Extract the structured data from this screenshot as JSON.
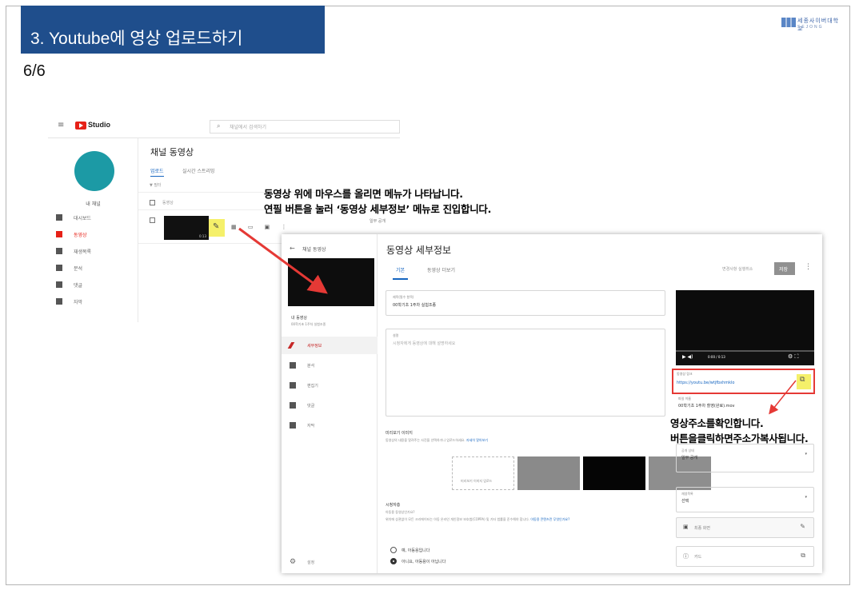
{
  "slide": {
    "title": "3. Youtube에 영상 업로드하기",
    "page": "6/6",
    "logo_text": "세종사이버대학교"
  },
  "callouts": {
    "hover_line1": "동영상 위에 마우스를 올리면 메뉴가 나타납니다.",
    "hover_line2": "연필 버튼을 눌러 ‘동영상 세부정보’ 메뉴로 진입합니다.",
    "url_line1": "영상주소를확인합니다.",
    "url_line2": "버튼을클릭하면주소가복사됩니다."
  },
  "studio_list": {
    "brand": "Studio",
    "channel_name": "내 채널",
    "page_title": "채널 동영상",
    "tabs": [
      "업로드",
      "실시간 스트리밍"
    ],
    "sidebar_items": [
      "대시보드",
      "동영상",
      "재생목록",
      "분석",
      "댓글",
      "자막"
    ],
    "video_duration": "0:13",
    "visibility": "일부 공개"
  },
  "studio_detail": {
    "back_label": "채널 동영상",
    "page_title": "동영상 세부정보",
    "tabs": [
      "기본",
      "동영상 더보기"
    ],
    "undo_label": "변경사항 실행취소",
    "save_label": "저장",
    "side_video_title": "내 동영상",
    "side_video_sub": "00학기초 1주차 실험조종",
    "sidebar_items": [
      "세부정보",
      "분석",
      "편집기",
      "댓글",
      "자막"
    ],
    "settings_label": "설정",
    "title_field_label": "제목(필수 항목)",
    "title_field_value": "00학기초 1주차 실험조종",
    "desc_field_label": "설명",
    "desc_placeholder": "시청자에게 동영상에 대해 설명하세요",
    "thumb_section": "미리보기 이미지",
    "thumb_upload": "미리보기 이미지 업로드",
    "audience_section": "시청자층",
    "audience_question": "아동용 동영상인가요?",
    "radio_yes": "예, 아동용입니다",
    "radio_no": "아니요, 아동용이 아닙니다",
    "video_time": "0:00 / 0:13",
    "url_label": "동영상 링크",
    "url_value": "https://youtu.be/wtjfbxhmklo",
    "filename_label": "파일 이름",
    "filename_value": "00학기초 1주차 촬영(완료).mov",
    "visibility_label": "공개 상태",
    "visibility_value": "일부 공개",
    "playlist_label": "재생목록",
    "playlist_value": "선택",
    "endscreen_label": "최종 화면",
    "cards_label": "카드"
  }
}
